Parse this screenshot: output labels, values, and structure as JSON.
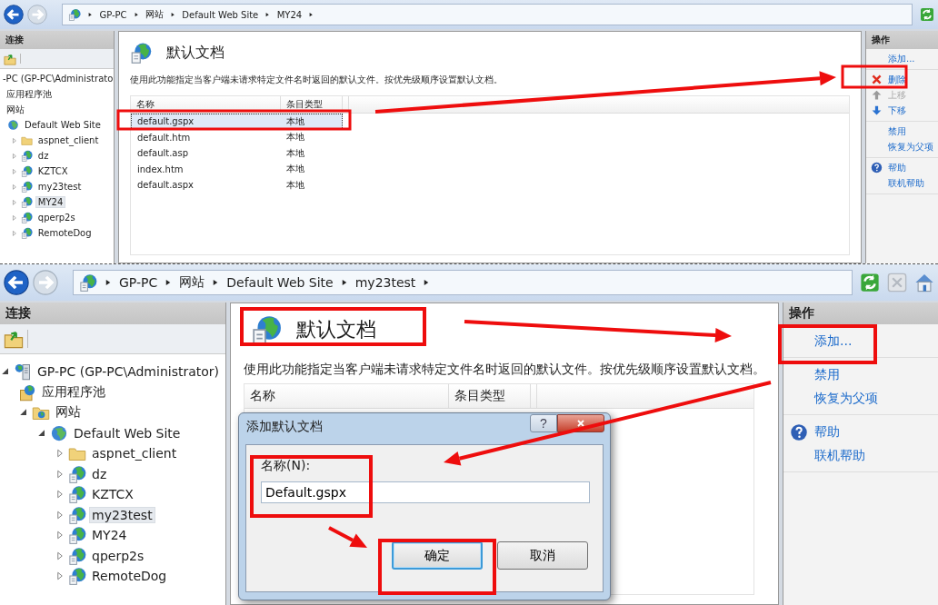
{
  "panels": [
    {
      "address": {
        "crumbs": [
          "GP-PC",
          "网站",
          "Default Web Site",
          "MY24"
        ]
      },
      "toolbar": [
        {
          "kind": "refresh"
        }
      ],
      "connections": {
        "title": "连接",
        "tree": [
          {
            "label": "-PC (GP-PC\\Administrato",
            "kind": "plain",
            "selected": false,
            "children": [
              {
                "label": "应用程序池",
                "kind": "plain",
                "selected": false
              },
              {
                "label": "网站",
                "kind": "plain",
                "selected": false,
                "children": [
                  {
                    "label": "Default Web Site",
                    "kind": "site",
                    "selected": false,
                    "children": [
                      {
                        "label": "aspnet_client",
                        "kind": "folder",
                        "expanded": false,
                        "selected": false
                      },
                      {
                        "label": "dz",
                        "kind": "app",
                        "expanded": false,
                        "selected": false
                      },
                      {
                        "label": "KZTCX",
                        "kind": "app",
                        "expanded": false,
                        "selected": false
                      },
                      {
                        "label": "my23test",
                        "kind": "app",
                        "expanded": false,
                        "selected": false
                      },
                      {
                        "label": "MY24",
                        "kind": "app",
                        "expanded": false,
                        "selected": true
                      },
                      {
                        "label": "qperp2s",
                        "kind": "app",
                        "expanded": false,
                        "selected": false
                      },
                      {
                        "label": "RemoteDog",
                        "kind": "app",
                        "expanded": false,
                        "selected": false
                      }
                    ]
                  }
                ]
              }
            ]
          }
        ]
      },
      "feature": {
        "title": "默认文档",
        "description": "使用此功能指定当客户端未请求特定文件名时返回的默认文件。按优先级顺序设置默认文档。",
        "columns": [
          "名称",
          "条目类型"
        ],
        "rows": [
          {
            "name": "default.gspx",
            "type": "本地",
            "selected": true
          },
          {
            "name": "default.htm",
            "type": "本地",
            "selected": false
          },
          {
            "name": "default.asp",
            "type": "本地",
            "selected": false
          },
          {
            "name": "index.htm",
            "type": "本地",
            "selected": false
          },
          {
            "name": "default.aspx",
            "type": "本地",
            "selected": false
          }
        ]
      },
      "actions": {
        "title": "操作",
        "groups": [
          [
            {
              "label": "添加...",
              "kind": "none",
              "disabled": false
            }
          ],
          [
            {
              "label": "删除",
              "kind": "delete",
              "disabled": false
            },
            {
              "label": "上移",
              "kind": "up",
              "disabled": true
            },
            {
              "label": "下移",
              "kind": "down",
              "disabled": false
            }
          ],
          [
            {
              "label": "禁用",
              "kind": "none",
              "disabled": false
            },
            {
              "label": "恢复为父项",
              "kind": "none",
              "disabled": false
            }
          ],
          [
            {
              "label": "帮助",
              "kind": "help",
              "disabled": false
            },
            {
              "label": "联机帮助",
              "kind": "none",
              "disabled": false
            }
          ]
        ]
      }
    },
    {
      "address": {
        "crumbs": [
          "GP-PC",
          "网站",
          "Default Web Site",
          "my23test"
        ]
      },
      "toolbar": [
        {
          "kind": "refresh"
        },
        {
          "kind": "stop"
        },
        {
          "kind": "home"
        }
      ],
      "connections": {
        "title": "连接",
        "tree": [
          {
            "label": "GP-PC (GP-PC\\Administrator)",
            "kind": "server",
            "expanded": true,
            "selected": false,
            "children": [
              {
                "label": "应用程序池",
                "kind": "pool",
                "selected": false
              },
              {
                "label": "网站",
                "kind": "sites",
                "expanded": true,
                "selected": false,
                "children": [
                  {
                    "label": "Default Web Site",
                    "kind": "site",
                    "expanded": true,
                    "selected": false,
                    "children": [
                      {
                        "label": "aspnet_client",
                        "kind": "folder",
                        "expanded": false,
                        "selected": false
                      },
                      {
                        "label": "dz",
                        "kind": "app",
                        "expanded": false,
                        "selected": false
                      },
                      {
                        "label": "KZTCX",
                        "kind": "app",
                        "expanded": false,
                        "selected": false
                      },
                      {
                        "label": "my23test",
                        "kind": "app",
                        "expanded": false,
                        "selected": true
                      },
                      {
                        "label": "MY24",
                        "kind": "app",
                        "expanded": false,
                        "selected": false
                      },
                      {
                        "label": "qperp2s",
                        "kind": "app",
                        "expanded": false,
                        "selected": false
                      },
                      {
                        "label": "RemoteDog",
                        "kind": "app",
                        "expanded": false,
                        "selected": false
                      }
                    ]
                  }
                ]
              }
            ]
          }
        ]
      },
      "feature": {
        "title": "默认文档",
        "description": "使用此功能指定当客户端未请求特定文件名时返回的默认文件。按优先级顺序设置默认文档。",
        "columns": [
          "名称",
          "条目类型"
        ]
      },
      "actions": {
        "title": "操作",
        "groups": [
          [
            {
              "label": "添加...",
              "kind": "none",
              "disabled": false
            }
          ],
          [
            {
              "label": "禁用",
              "kind": "none",
              "disabled": false
            },
            {
              "label": "恢复为父项",
              "kind": "none",
              "disabled": false
            }
          ],
          [
            {
              "label": "帮助",
              "kind": "help",
              "disabled": false
            },
            {
              "label": "联机帮助",
              "kind": "none",
              "disabled": false
            }
          ]
        ]
      },
      "dialog": {
        "title": "添加默认文档",
        "help_button": "?",
        "label": "名称(N):",
        "value": "Default.gspx",
        "buttons": [
          {
            "label": "确定",
            "default": true
          },
          {
            "label": "取消",
            "default": false
          }
        ]
      }
    }
  ]
}
